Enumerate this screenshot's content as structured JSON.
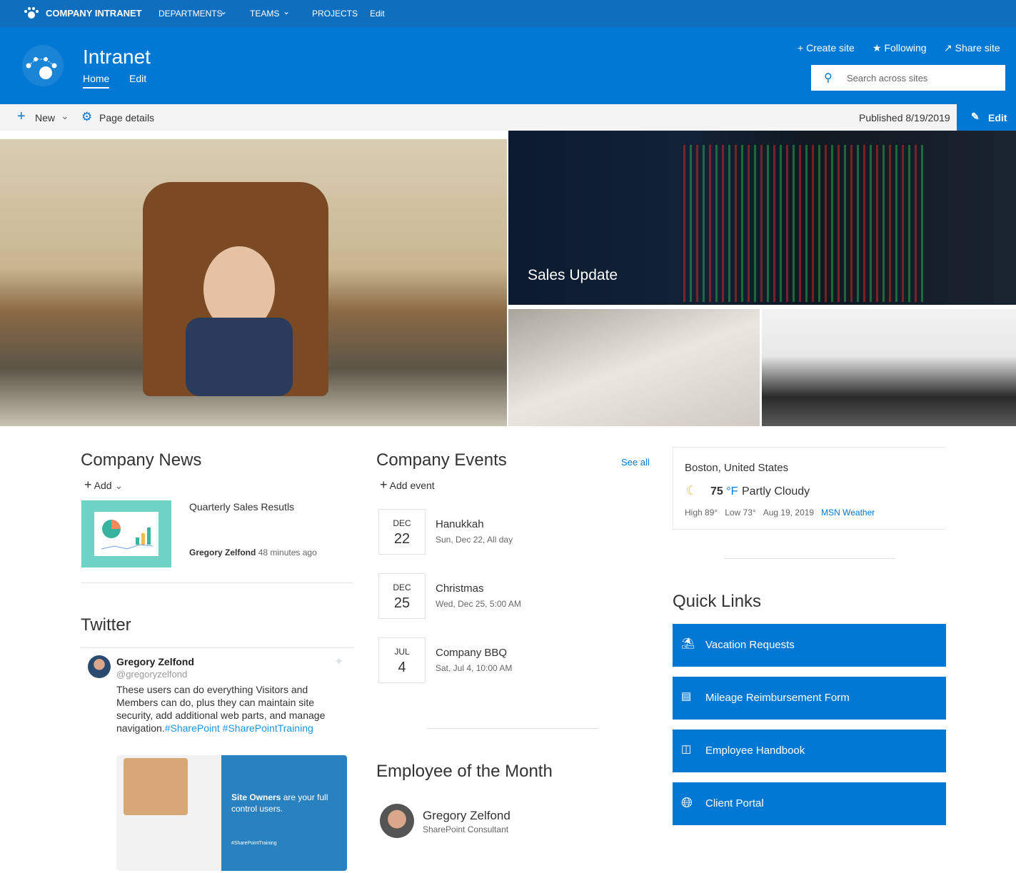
{
  "topnav": {
    "brand": "COMPANY INTRANET",
    "items": [
      "DEPARTMENTS",
      "TEAMS",
      "PROJECTS",
      "Edit"
    ]
  },
  "header": {
    "title": "Intranet",
    "tabs": [
      "Home",
      "Edit"
    ],
    "actions": {
      "create": "Create site",
      "following": "Following",
      "share": "Share site"
    },
    "search_placeholder": "Search across sites"
  },
  "command_bar": {
    "new": "New",
    "page_details": "Page details",
    "published": "Published 8/19/2019",
    "edit": "Edit"
  },
  "hero": {
    "tile_caption": "Sales Update"
  },
  "news": {
    "title": "Company News",
    "add": "Add",
    "item": {
      "title": "Quarterly Sales Resutls",
      "author": "Gregory Zelfond",
      "time": "48 minutes ago"
    }
  },
  "twitter": {
    "title": "Twitter",
    "name": "Gregory Zelfond",
    "handle": "@gregoryzelfond",
    "text": "These users can do everything Visitors and Members can do, plus they can maintain site security, add additional web parts, and manage navigation.",
    "tags": "#SharePoint #SharePointTraining",
    "card_bold": "Site Owners",
    "card_text": " are your full control users.",
    "card_tag": "#SharePointTraining"
  },
  "events": {
    "title": "Company Events",
    "see_all": "See all",
    "add": "Add event",
    "items": [
      {
        "month": "DEC",
        "day": "22",
        "title": "Hanukkah",
        "sub": "Sun, Dec 22, All day"
      },
      {
        "month": "DEC",
        "day": "25",
        "title": "Christmas",
        "sub": "Wed, Dec 25, 5:00 AM"
      },
      {
        "month": "JUL",
        "day": "4",
        "title": "Company BBQ",
        "sub": "Sat, Jul 4, 10:00 AM"
      }
    ]
  },
  "employee": {
    "title": "Employee of the Month",
    "name": "Gregory Zelfond",
    "role": "SharePoint Consultant"
  },
  "weather": {
    "location": "Boston, United States",
    "temp": "75",
    "unit": "°F",
    "condition": "Partly Cloudy",
    "high": "High 89°",
    "low": "Low 73°",
    "date": "Aug 19, 2019",
    "source": "MSN Weather",
    "icon": "moon-cloud-icon"
  },
  "quick_links": {
    "title": "Quick Links",
    "items": [
      {
        "label": "Vacation Requests",
        "icon": "beach-icon"
      },
      {
        "label": "Mileage Reimbursement Form",
        "icon": "form-icon"
      },
      {
        "label": "Employee Handbook",
        "icon": "book-icon"
      },
      {
        "label": "Client Portal",
        "icon": "globe-icon"
      }
    ]
  },
  "colors": {
    "theme": "#0078d4",
    "topbar": "#106ebe"
  }
}
